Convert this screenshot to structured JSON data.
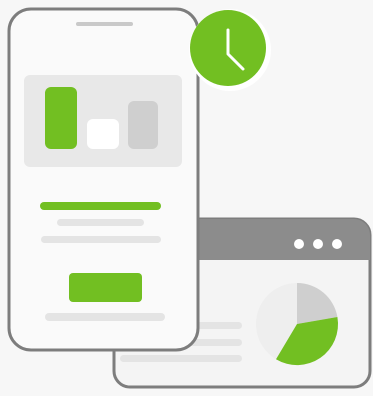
{
  "illustration": {
    "colors": {
      "background": "#f7f7f7",
      "accent": "#72bf22",
      "outline": "#7d7d7d",
      "screen_panel": "#e8e8e8",
      "placeholder": "#e4e4e4",
      "window_titlebar": "#8c8c8c",
      "window_body": "#f4f4f4",
      "white": "#ffffff"
    },
    "icons": {
      "clock": "clock-icon",
      "window_menu": "ellipsis-icon",
      "pie": "pie-chart-icon"
    },
    "phone": {
      "chart_bars": [
        {
          "name": "left",
          "color": "#72bf22"
        },
        {
          "name": "middle",
          "color": "#ffffff"
        },
        {
          "name": "right",
          "color": "#cfcfcf"
        }
      ],
      "primary_button_color": "#72bf22"
    },
    "window": {
      "pie_chart": {
        "slices": [
          {
            "name": "green",
            "color": "#72bf22"
          },
          {
            "name": "light-grey",
            "color": "#cfcfcf"
          },
          {
            "name": "white",
            "color": "#eeeeee"
          }
        ]
      }
    }
  }
}
